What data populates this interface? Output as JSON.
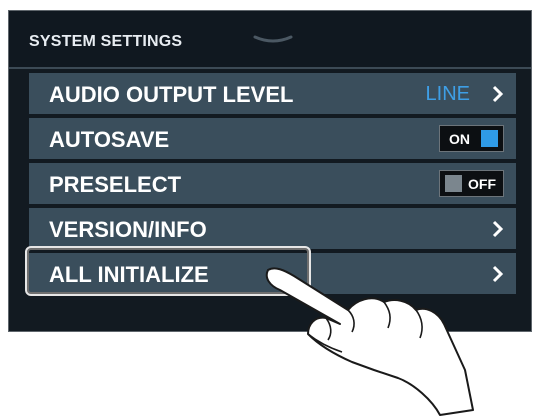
{
  "header": {
    "title": "SYSTEM SETTINGS"
  },
  "settings": {
    "audio_output_level": {
      "label": "AUDIO OUTPUT LEVEL",
      "value": "LINE"
    },
    "autosave": {
      "label": "AUTOSAVE",
      "toggle": "ON",
      "enabled": true
    },
    "preselect": {
      "label": "PRESELECT",
      "toggle": "OFF",
      "enabled": false
    },
    "version_info": {
      "label": "VERSION/INFO"
    },
    "all_initialize": {
      "label": "ALL INITIALIZE"
    }
  },
  "colors": {
    "row_background": "#3a4e5c",
    "value_accent": "#3e9fe6",
    "toggle_on": "#2f9be7",
    "toggle_off": "#7b868e",
    "screen_background": "#121a21"
  },
  "icons": [
    "chevron-right-icon",
    "drag-handle-icon",
    "pointing-hand-icon"
  ]
}
